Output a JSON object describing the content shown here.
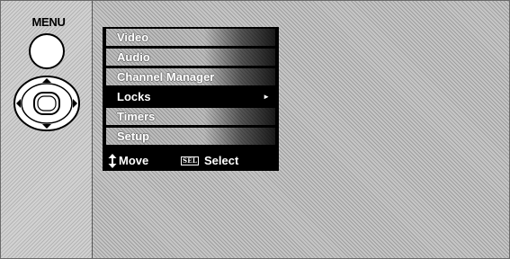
{
  "remote": {
    "menu_label": "MENU"
  },
  "menu": {
    "items": [
      {
        "label": "Video",
        "selected": false
      },
      {
        "label": "Audio",
        "selected": false
      },
      {
        "label": "Channel Manager",
        "selected": false
      },
      {
        "label": "Locks",
        "selected": true
      },
      {
        "label": "Timers",
        "selected": false
      },
      {
        "label": "Setup",
        "selected": false
      }
    ],
    "selected_arrow": "►",
    "hints": {
      "move_icon": "up-down-arrow-icon",
      "move_label": "Move",
      "select_key": "SEL",
      "select_label": "Select"
    }
  },
  "colors": {
    "osd_background": "#000000",
    "screen_background": "#c6c6c6"
  }
}
